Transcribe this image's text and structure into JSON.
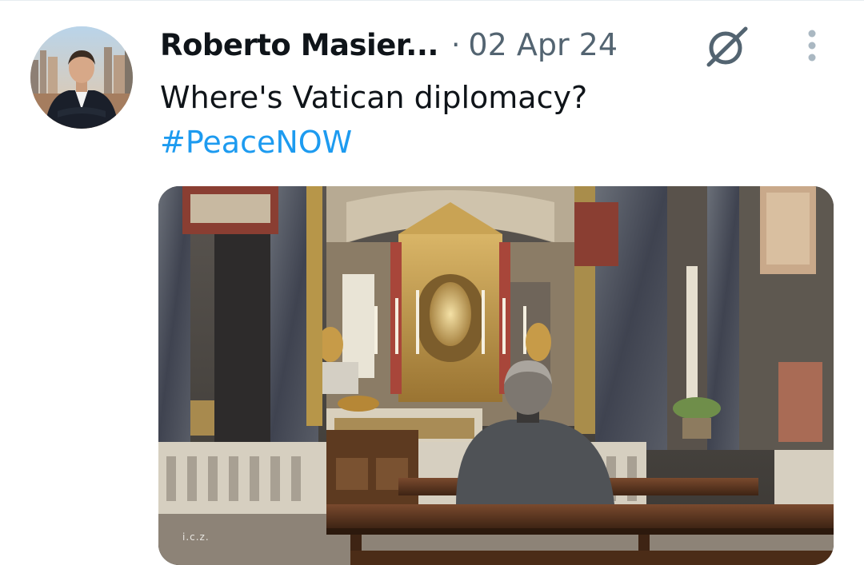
{
  "tweet": {
    "author_name": "Roberto Masier...",
    "separator": "·",
    "date": "02 Apr 24",
    "text": "Where's Vatican diplomacy?",
    "hashtag": "#PeaceNOW",
    "media_watermark": "i.c.z."
  },
  "icons": {
    "grok": "grok-icon",
    "more": "more-vertical-icon"
  },
  "colors": {
    "text": "#0f1419",
    "secondary": "#536471",
    "link": "#1d9bf0"
  }
}
